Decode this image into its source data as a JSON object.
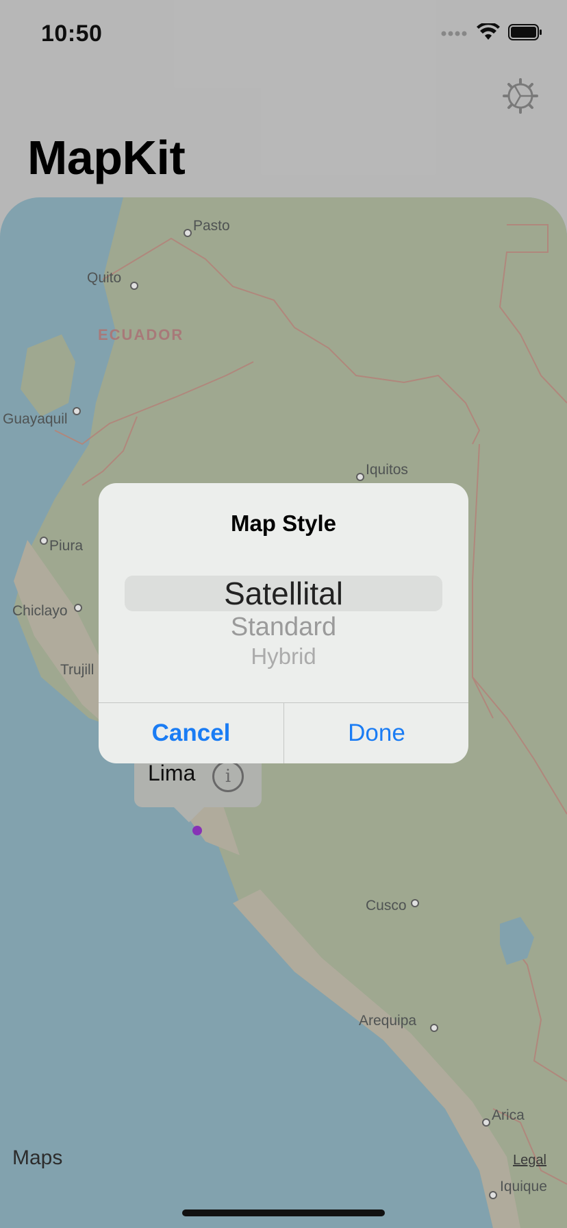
{
  "status_bar": {
    "time": "10:50"
  },
  "header": {
    "title": "MapKit",
    "settings_icon": "gear-icon"
  },
  "map": {
    "country_label": "ECUADOR",
    "cities": [
      "Pasto",
      "Quito",
      "Guayaquil",
      "Iquitos",
      "Piura",
      "Chiclayo",
      "Trujill",
      "Cusco",
      "Arequipa",
      "Arica",
      "Iquique"
    ],
    "attribution": "Maps",
    "legal": "Legal"
  },
  "callout": {
    "label": "Lima",
    "info_icon": "info-icon",
    "pin_color": "#9a3ad0"
  },
  "alert": {
    "title": "Map Style",
    "options": [
      "Satellital",
      "Standard",
      "Hybrid"
    ],
    "selected": "Satellital",
    "cancel_label": "Cancel",
    "done_label": "Done",
    "accent_color": "#1a7cf4"
  }
}
